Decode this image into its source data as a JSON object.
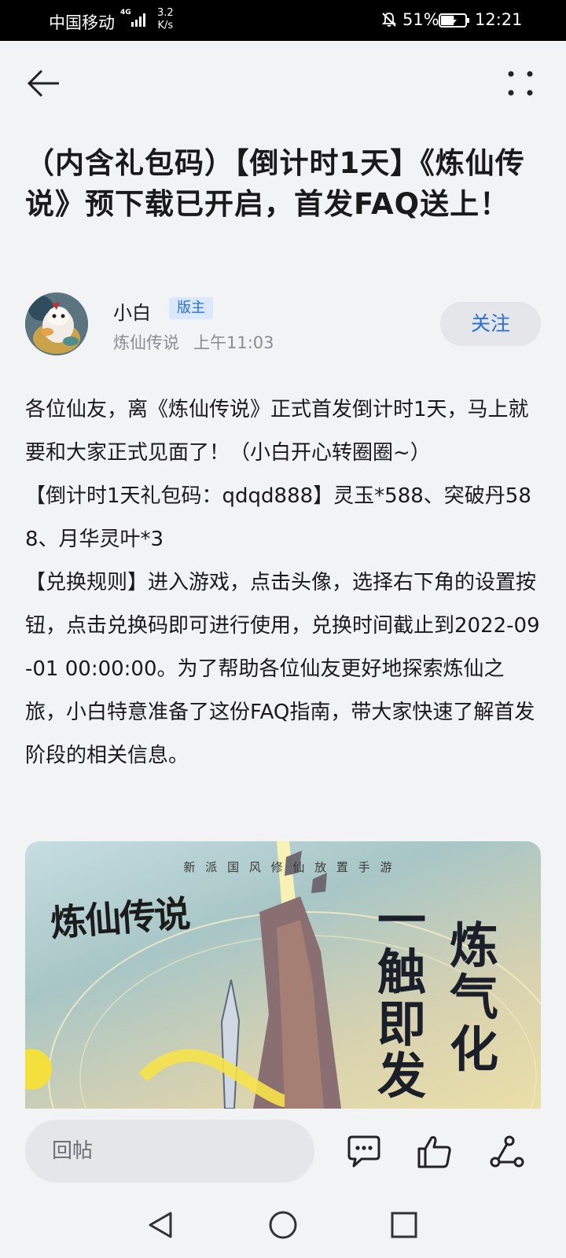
{
  "status_bar": {
    "carrier": "中国移动",
    "network": "4G",
    "speed_value": "3.2",
    "speed_unit": "K/s",
    "battery_percent": "51%",
    "time": "12:21"
  },
  "header": {
    "back_icon": "arrow-left-icon",
    "more_icon": "more-vertical-icon"
  },
  "post": {
    "title": "（内含礼包码）【倒计时1天】《炼仙传说》预下载已开启，首发FAQ送上！",
    "author": {
      "name": "小白",
      "badge": "版主",
      "forum": "炼仙传说",
      "time": "上午11:03"
    },
    "follow_label": "关注",
    "paragraphs": [
      "各位仙友，离《炼仙传说》正式首发倒计时1天，马上就要和大家正式见面了！（小白开心转圈圈~）",
      "【倒计时1天礼包码：qdqd888】灵玉*588、突破丹588、月华灵叶*3",
      "【兑换规则】进入游戏，点击头像，选择右下角的设置按钮，点击兑换码即可进行使用，兑换时间截止到2022-09-01 00:00:00。为了帮助各位仙友更好地探索炼仙之旅，小白特意准备了这份FAQ指南，带大家快速了解首发阶段的相关信息。"
    ],
    "banner": {
      "tagline": "新 派 国 风 修 仙 放 置 手 游",
      "logo_text": "炼仙传说",
      "slogan_col1": "一触即发",
      "slogan_col2": "炼气化"
    }
  },
  "bottom_bar": {
    "reply_placeholder": "回帖",
    "icons": [
      "comment-icon",
      "like-icon",
      "share-icon"
    ]
  },
  "system_nav": [
    "back-triangle-icon",
    "home-circle-icon",
    "recents-square-icon"
  ]
}
